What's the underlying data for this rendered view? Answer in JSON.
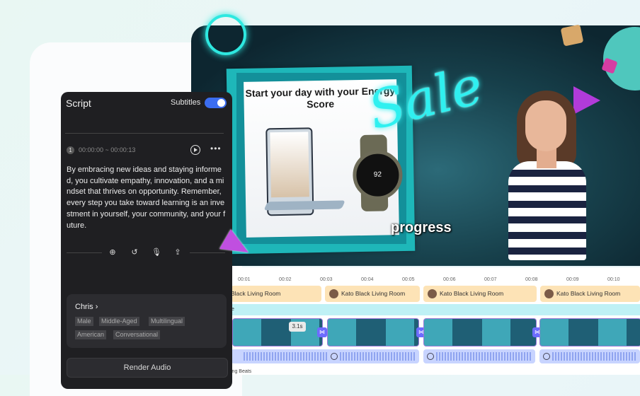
{
  "script_panel": {
    "title": "Script",
    "subtitles_label": "Subtitles",
    "subtitles_on": true,
    "segment_number": "1",
    "segment_time": "00:00:00 ~ 00:00:13",
    "body": "By embracing new ideas and staying informed, you cultivate empathy, innovation, and a mindset that thrives on opportunity. Remember, every step you take toward learning is an investment in yourself, your community, and your future.",
    "voice": {
      "name": "Chris",
      "tags": [
        "Male",
        "Middle-Aged",
        "Multilingual",
        "American",
        "Conversational"
      ]
    },
    "render_label": "Render Audio"
  },
  "video": {
    "product_title": "Start your day with your Energy Score",
    "watch_value": "92",
    "sale_text": "Sale",
    "caption": "progress"
  },
  "timeline": {
    "ruler": [
      "00:01",
      "00:02",
      "00:03",
      "00:04",
      "00:05",
      "00:06",
      "00:07",
      "00:08",
      "00:09",
      "00:10"
    ],
    "clips": [
      {
        "label": "Black Living Room"
      },
      {
        "label": "Kato Black Living Room"
      },
      {
        "label": "Kato Black Living Room"
      },
      {
        "label": "Kato Black Living Room"
      }
    ],
    "cyan_label": "e",
    "duration_badge": "3.1s",
    "beats_label": "ing Beats"
  },
  "colors": {
    "accent": "#3b6df0",
    "neon": "#2ff0f0",
    "clip": "#fde3b6",
    "audio": "#c8d4ff"
  }
}
